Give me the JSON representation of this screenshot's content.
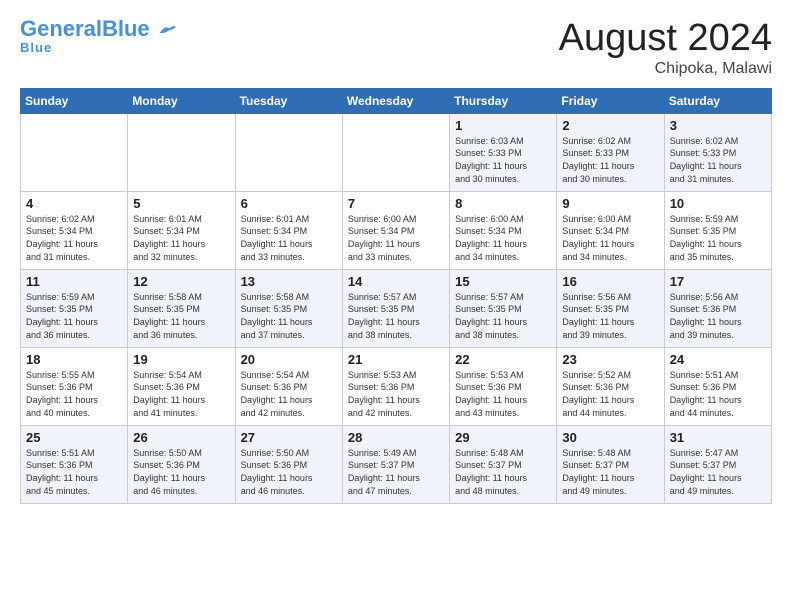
{
  "header": {
    "logo_general": "General",
    "logo_blue": "Blue",
    "month_title": "August 2024",
    "location": "Chipoka, Malawi"
  },
  "weekdays": [
    "Sunday",
    "Monday",
    "Tuesday",
    "Wednesday",
    "Thursday",
    "Friday",
    "Saturday"
  ],
  "weeks": [
    [
      {
        "day": "",
        "info": ""
      },
      {
        "day": "",
        "info": ""
      },
      {
        "day": "",
        "info": ""
      },
      {
        "day": "",
        "info": ""
      },
      {
        "day": "1",
        "info": "Sunrise: 6:03 AM\nSunset: 5:33 PM\nDaylight: 11 hours\nand 30 minutes."
      },
      {
        "day": "2",
        "info": "Sunrise: 6:02 AM\nSunset: 5:33 PM\nDaylight: 11 hours\nand 30 minutes."
      },
      {
        "day": "3",
        "info": "Sunrise: 6:02 AM\nSunset: 5:33 PM\nDaylight: 11 hours\nand 31 minutes."
      }
    ],
    [
      {
        "day": "4",
        "info": "Sunrise: 6:02 AM\nSunset: 5:34 PM\nDaylight: 11 hours\nand 31 minutes."
      },
      {
        "day": "5",
        "info": "Sunrise: 6:01 AM\nSunset: 5:34 PM\nDaylight: 11 hours\nand 32 minutes."
      },
      {
        "day": "6",
        "info": "Sunrise: 6:01 AM\nSunset: 5:34 PM\nDaylight: 11 hours\nand 33 minutes."
      },
      {
        "day": "7",
        "info": "Sunrise: 6:00 AM\nSunset: 5:34 PM\nDaylight: 11 hours\nand 33 minutes."
      },
      {
        "day": "8",
        "info": "Sunrise: 6:00 AM\nSunset: 5:34 PM\nDaylight: 11 hours\nand 34 minutes."
      },
      {
        "day": "9",
        "info": "Sunrise: 6:00 AM\nSunset: 5:34 PM\nDaylight: 11 hours\nand 34 minutes."
      },
      {
        "day": "10",
        "info": "Sunrise: 5:59 AM\nSunset: 5:35 PM\nDaylight: 11 hours\nand 35 minutes."
      }
    ],
    [
      {
        "day": "11",
        "info": "Sunrise: 5:59 AM\nSunset: 5:35 PM\nDaylight: 11 hours\nand 36 minutes."
      },
      {
        "day": "12",
        "info": "Sunrise: 5:58 AM\nSunset: 5:35 PM\nDaylight: 11 hours\nand 36 minutes."
      },
      {
        "day": "13",
        "info": "Sunrise: 5:58 AM\nSunset: 5:35 PM\nDaylight: 11 hours\nand 37 minutes."
      },
      {
        "day": "14",
        "info": "Sunrise: 5:57 AM\nSunset: 5:35 PM\nDaylight: 11 hours\nand 38 minutes."
      },
      {
        "day": "15",
        "info": "Sunrise: 5:57 AM\nSunset: 5:35 PM\nDaylight: 11 hours\nand 38 minutes."
      },
      {
        "day": "16",
        "info": "Sunrise: 5:56 AM\nSunset: 5:35 PM\nDaylight: 11 hours\nand 39 minutes."
      },
      {
        "day": "17",
        "info": "Sunrise: 5:56 AM\nSunset: 5:36 PM\nDaylight: 11 hours\nand 39 minutes."
      }
    ],
    [
      {
        "day": "18",
        "info": "Sunrise: 5:55 AM\nSunset: 5:36 PM\nDaylight: 11 hours\nand 40 minutes."
      },
      {
        "day": "19",
        "info": "Sunrise: 5:54 AM\nSunset: 5:36 PM\nDaylight: 11 hours\nand 41 minutes."
      },
      {
        "day": "20",
        "info": "Sunrise: 5:54 AM\nSunset: 5:36 PM\nDaylight: 11 hours\nand 42 minutes."
      },
      {
        "day": "21",
        "info": "Sunrise: 5:53 AM\nSunset: 5:36 PM\nDaylight: 11 hours\nand 42 minutes."
      },
      {
        "day": "22",
        "info": "Sunrise: 5:53 AM\nSunset: 5:36 PM\nDaylight: 11 hours\nand 43 minutes."
      },
      {
        "day": "23",
        "info": "Sunrise: 5:52 AM\nSunset: 5:36 PM\nDaylight: 11 hours\nand 44 minutes."
      },
      {
        "day": "24",
        "info": "Sunrise: 5:51 AM\nSunset: 5:36 PM\nDaylight: 11 hours\nand 44 minutes."
      }
    ],
    [
      {
        "day": "25",
        "info": "Sunrise: 5:51 AM\nSunset: 5:36 PM\nDaylight: 11 hours\nand 45 minutes."
      },
      {
        "day": "26",
        "info": "Sunrise: 5:50 AM\nSunset: 5:36 PM\nDaylight: 11 hours\nand 46 minutes."
      },
      {
        "day": "27",
        "info": "Sunrise: 5:50 AM\nSunset: 5:36 PM\nDaylight: 11 hours\nand 46 minutes."
      },
      {
        "day": "28",
        "info": "Sunrise: 5:49 AM\nSunset: 5:37 PM\nDaylight: 11 hours\nand 47 minutes."
      },
      {
        "day": "29",
        "info": "Sunrise: 5:48 AM\nSunset: 5:37 PM\nDaylight: 11 hours\nand 48 minutes."
      },
      {
        "day": "30",
        "info": "Sunrise: 5:48 AM\nSunset: 5:37 PM\nDaylight: 11 hours\nand 49 minutes."
      },
      {
        "day": "31",
        "info": "Sunrise: 5:47 AM\nSunset: 5:37 PM\nDaylight: 11 hours\nand 49 minutes."
      }
    ]
  ]
}
